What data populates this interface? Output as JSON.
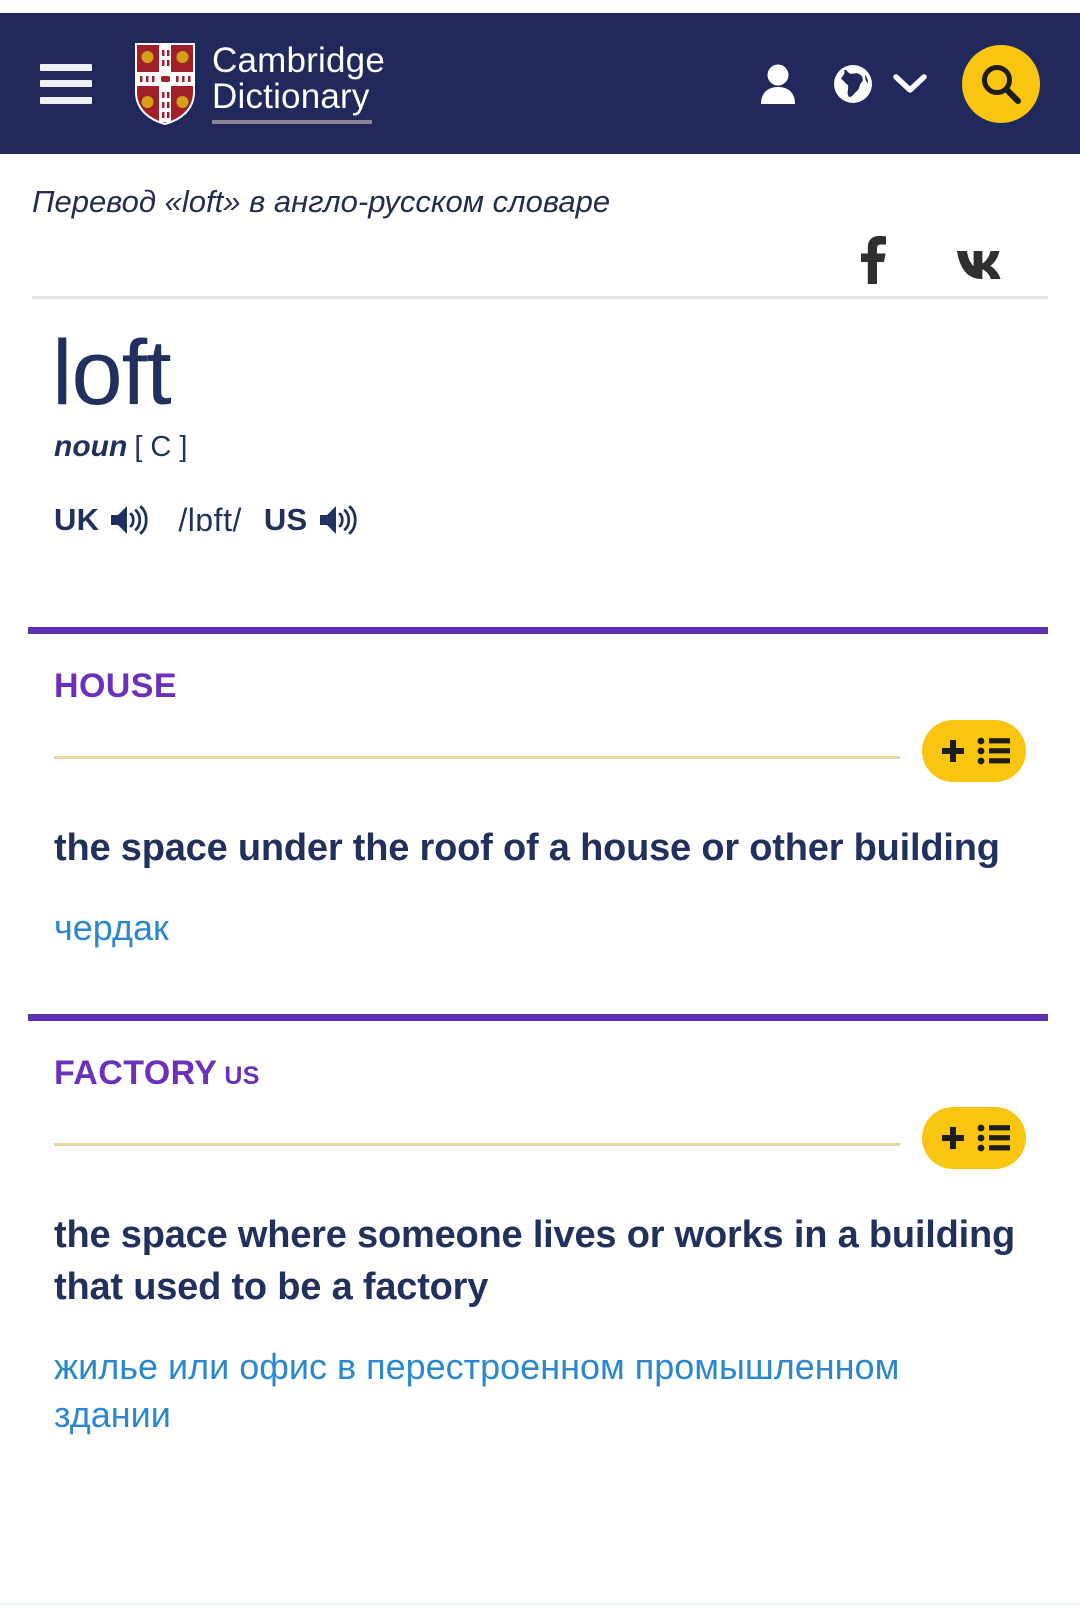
{
  "header": {
    "menu_icon": "hamburger-menu-icon",
    "brand_line1": "Cambridge",
    "brand_line2": "Dictionary",
    "crest_icon": "cambridge-crest-icon",
    "account_icon": "person-icon",
    "language_icon": "globe-icon",
    "language_chevron_icon": "chevron-down-icon",
    "search_icon": "search-icon",
    "background_color": "#20285c",
    "accent_color": "#f9c511"
  },
  "page": {
    "subtitle": "Перевод «loft» в англо-русском словаре"
  },
  "share": {
    "facebook_label": "f",
    "facebook_icon": "facebook-icon",
    "vk_label": "vk",
    "vk_icon": "vk-icon"
  },
  "entry": {
    "headword": "loft",
    "part_of_speech": "noun",
    "grammar": "[ C ]",
    "uk_label": "UK",
    "us_label": "US",
    "ipa": "/lɒft/",
    "speaker_icon": "speaker-audio-icon"
  },
  "senses": [
    {
      "guideword": "HOUSE",
      "region_tag": "",
      "definition": "the space under the roof of a house or other building",
      "translation": "чердак",
      "wordlist_plus_icon": "plus-icon",
      "wordlist_list_icon": "list-icon",
      "divider_color": "#5b33b0",
      "guideword_color": "#6b31bd"
    },
    {
      "guideword": "FACTORY",
      "region_tag": "US",
      "definition": "the space where someone lives or works in a building that used to be a factory",
      "translation": "жилье или офис в перестроенном промышленном здании",
      "wordlist_plus_icon": "plus-icon",
      "wordlist_list_icon": "list-icon",
      "divider_color": "#5b33b0",
      "guideword_color": "#6b31bd"
    }
  ]
}
